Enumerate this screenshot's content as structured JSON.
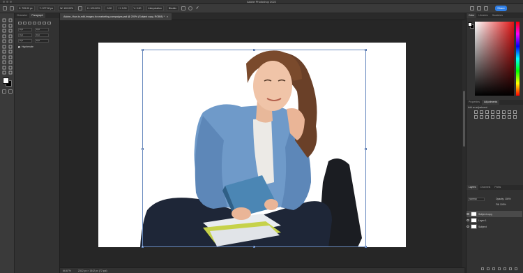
{
  "app": {
    "title": "Adobe Photoshop 2022"
  },
  "options_bar": {
    "fields": [
      "X: 709.00 px",
      "Y: 577.00 px",
      "W: 100.00%",
      "H: 100.00%",
      "0.00",
      "H: 0.00",
      "V: 0.00"
    ],
    "interpolation": "Interpolation",
    "mode": "Bicubic"
  },
  "share_button": "Share",
  "left_panel": {
    "tabs": [
      "Character",
      "Paragraph"
    ],
    "fields": [
      [
        "0 pt",
        "0 pt"
      ],
      [
        "0 pt",
        "0 pt"
      ],
      [
        "0 pt",
        "0 pt"
      ]
    ],
    "hyphenate": "Hyphenate"
  },
  "document": {
    "tab_title": "Adobe_How-to-edit-images-for-marketing-campaigns.psd @ 200% (Subject copy, RGB/8) *",
    "close": "×"
  },
  "status_bar": {
    "zoom": "66.67%",
    "info": "2312 px × 1542 px (72 ppi)"
  },
  "right_panel": {
    "color_tabs": [
      "Color",
      "Libraries",
      "Swatches"
    ],
    "adj_tabs": [
      "Properties",
      "Adjustments"
    ],
    "adj_label": "Add an adjustment",
    "layers_tabs": [
      "Layers",
      "Channels",
      "Paths"
    ],
    "layer_mode": "Normal",
    "opacity": "Opacity: 100%",
    "fill": "Fill: 100%",
    "layers": [
      {
        "name": "Subject copy",
        "selected": true
      },
      {
        "name": "Layer 1",
        "selected": false
      },
      {
        "name": "Subject",
        "selected": false
      }
    ]
  },
  "colors": {
    "accent": "#2f7fe6",
    "panel": "#323232",
    "canvas_bg": "#262626",
    "color_field_hue": "#e01515"
  },
  "icons": [
    "move-tool-icon",
    "artboard-icon",
    "marquee-tool-icon",
    "lasso-tool-icon",
    "quick-select-icon",
    "crop-tool-icon",
    "frame-tool-icon",
    "eyedropper-icon",
    "healing-brush-icon",
    "brush-tool-icon",
    "clone-stamp-icon",
    "history-brush-icon",
    "eraser-icon",
    "gradient-icon",
    "blur-icon",
    "dodge-icon",
    "pen-tool-icon",
    "type-tool-icon",
    "path-select-icon",
    "rectangle-tool-icon",
    "hand-tool-icon",
    "zoom-tool-icon"
  ]
}
